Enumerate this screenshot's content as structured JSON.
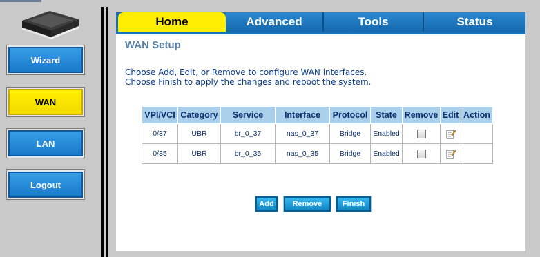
{
  "sidebar": {
    "items": [
      {
        "label": "Wizard"
      },
      {
        "label": "WAN"
      },
      {
        "label": "LAN"
      },
      {
        "label": "Logout"
      }
    ],
    "active": "WAN"
  },
  "tabs": [
    {
      "label": "Home"
    },
    {
      "label": "Advanced"
    },
    {
      "label": "Tools"
    },
    {
      "label": "Status"
    }
  ],
  "active_tab": "Home",
  "page": {
    "title": "WAN Setup",
    "description_line1": "Choose Add, Edit, or Remove to configure WAN interfaces.",
    "description_line2": "Choose Finish to apply the changes and reboot the system."
  },
  "table": {
    "headers": [
      "VPI/VCI",
      "Category",
      "Service",
      "Interface",
      "Protocol",
      "State",
      "Remove",
      "Edit",
      "Action"
    ],
    "rows": [
      {
        "vpivci": "0/37",
        "category": "UBR",
        "service": "br_0_37",
        "interface": "nas_0_37",
        "protocol": "Bridge",
        "state": "Enabled",
        "remove": false
      },
      {
        "vpivci": "0/35",
        "category": "UBR",
        "service": "br_0_35",
        "interface": "nas_0_35",
        "protocol": "Bridge",
        "state": "Enabled",
        "remove": false
      }
    ]
  },
  "buttons": {
    "add": "Add",
    "remove": "Remove",
    "finish": "Finish"
  },
  "colors": {
    "accent_yellow": "#ffee00",
    "tab_blue": "#1a6fb5",
    "header_cell": "#aad0ec",
    "text_blue": "#0a3d8f"
  }
}
